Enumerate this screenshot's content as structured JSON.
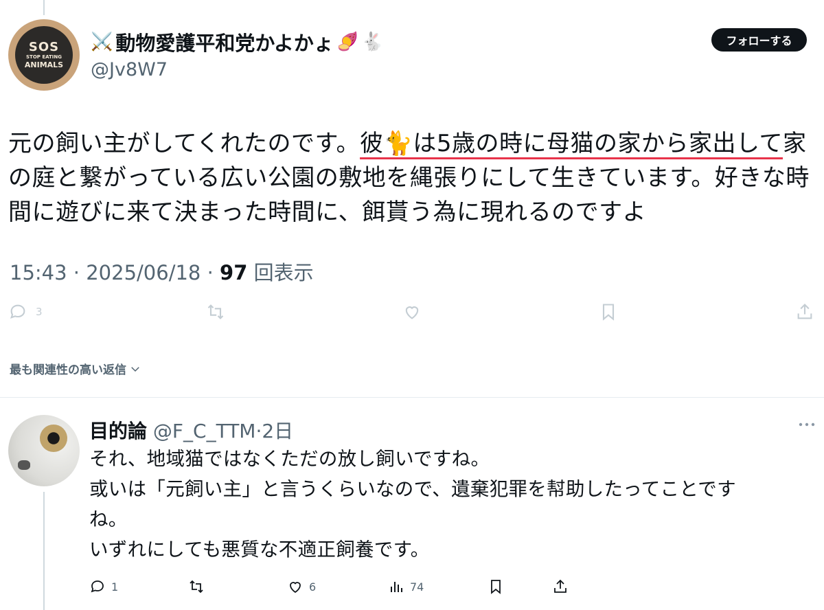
{
  "tweet": {
    "author": {
      "display_name": "動物愛護平和党かよかょ",
      "name_prefix_emoji": "⚔️",
      "name_suffix_emojis": [
        "🍠",
        "🐇"
      ],
      "handle": "@Jv8W7",
      "avatar_text": [
        "SOS",
        "STOP EATING",
        "ANIMALS"
      ]
    },
    "follow_label": "フォローする",
    "text_part1": "元の飼い主がしてくれたのです。",
    "text_highlight": "彼🐈は5歳の時に母猫の家から家出して",
    "text_part2": "家の庭と繋がっている広い公園の敷地を縄張りにして生きています。好きな時間に遊びに来て決まった時間に、餌貰う為に現れるのですよ",
    "time": "15:43",
    "date": "2025/06/18",
    "views_count": "97",
    "views_label": "回表示",
    "reply_count": "3",
    "icons": [
      "reply-icon",
      "retweet-icon",
      "like-icon",
      "bookmark-icon",
      "share-icon"
    ]
  },
  "sort_label": "最も関連性の高い返信",
  "reply": {
    "display_name": "目的論",
    "handle": "@F_C_TTM",
    "age": "2日",
    "lines": [
      "それ、地域猫ではなくただの放し飼いですね。",
      "或いは「元飼い主」と言うくらいなので、遺棄犯罪を幇助したってことです",
      "ね。",
      "いずれにしても悪質な不適正飼養です。"
    ],
    "reply_count": "1",
    "like_count": "6",
    "views_count": "74"
  }
}
